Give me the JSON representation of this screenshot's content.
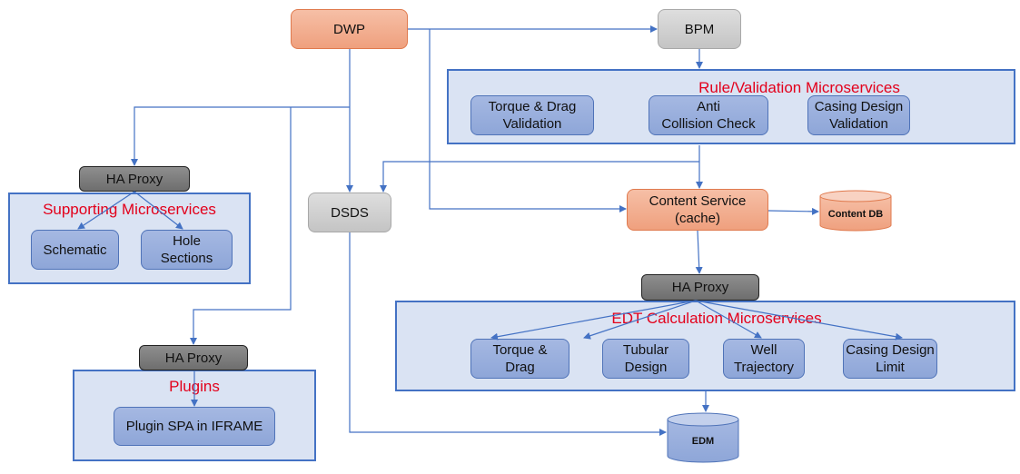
{
  "nodes": {
    "dwp": "DWP",
    "bpm": "BPM",
    "dsds": "DSDS",
    "content_service": "Content Service\n(cache)",
    "content_db": "Content DB",
    "edm": "EDM"
  },
  "groups": {
    "rule_validation": {
      "title": "Rule/Validation Microservices",
      "services": [
        "Torque & Drag\nValidation",
        "Anti\nCollision Check",
        "Casing Design\nValidation"
      ]
    },
    "supporting": {
      "proxy": "HA Proxy",
      "title": "Supporting Microservices",
      "services": [
        "Schematic",
        "Hole\nSections"
      ]
    },
    "plugins": {
      "proxy": "HA Proxy",
      "title": "Plugins",
      "services": [
        "Plugin SPA in IFRAME"
      ]
    },
    "edt_calc": {
      "proxy": "HA Proxy",
      "title": "EDT Calculation Microservices",
      "services": [
        "Torque &\nDrag",
        "Tubular\nDesign",
        "Well\nTrajectory",
        "Casing Design\nLimit"
      ]
    }
  },
  "colors": {
    "connector": "#4472c4",
    "group_fill": "#dae3f3",
    "group_border": "#4472c4",
    "group_title": "#e3001b",
    "orange_node": "#f4b183",
    "gray_node": "#d0d0d0",
    "proxy_node": "#7f7f7f",
    "service_node": "#8faadc"
  }
}
